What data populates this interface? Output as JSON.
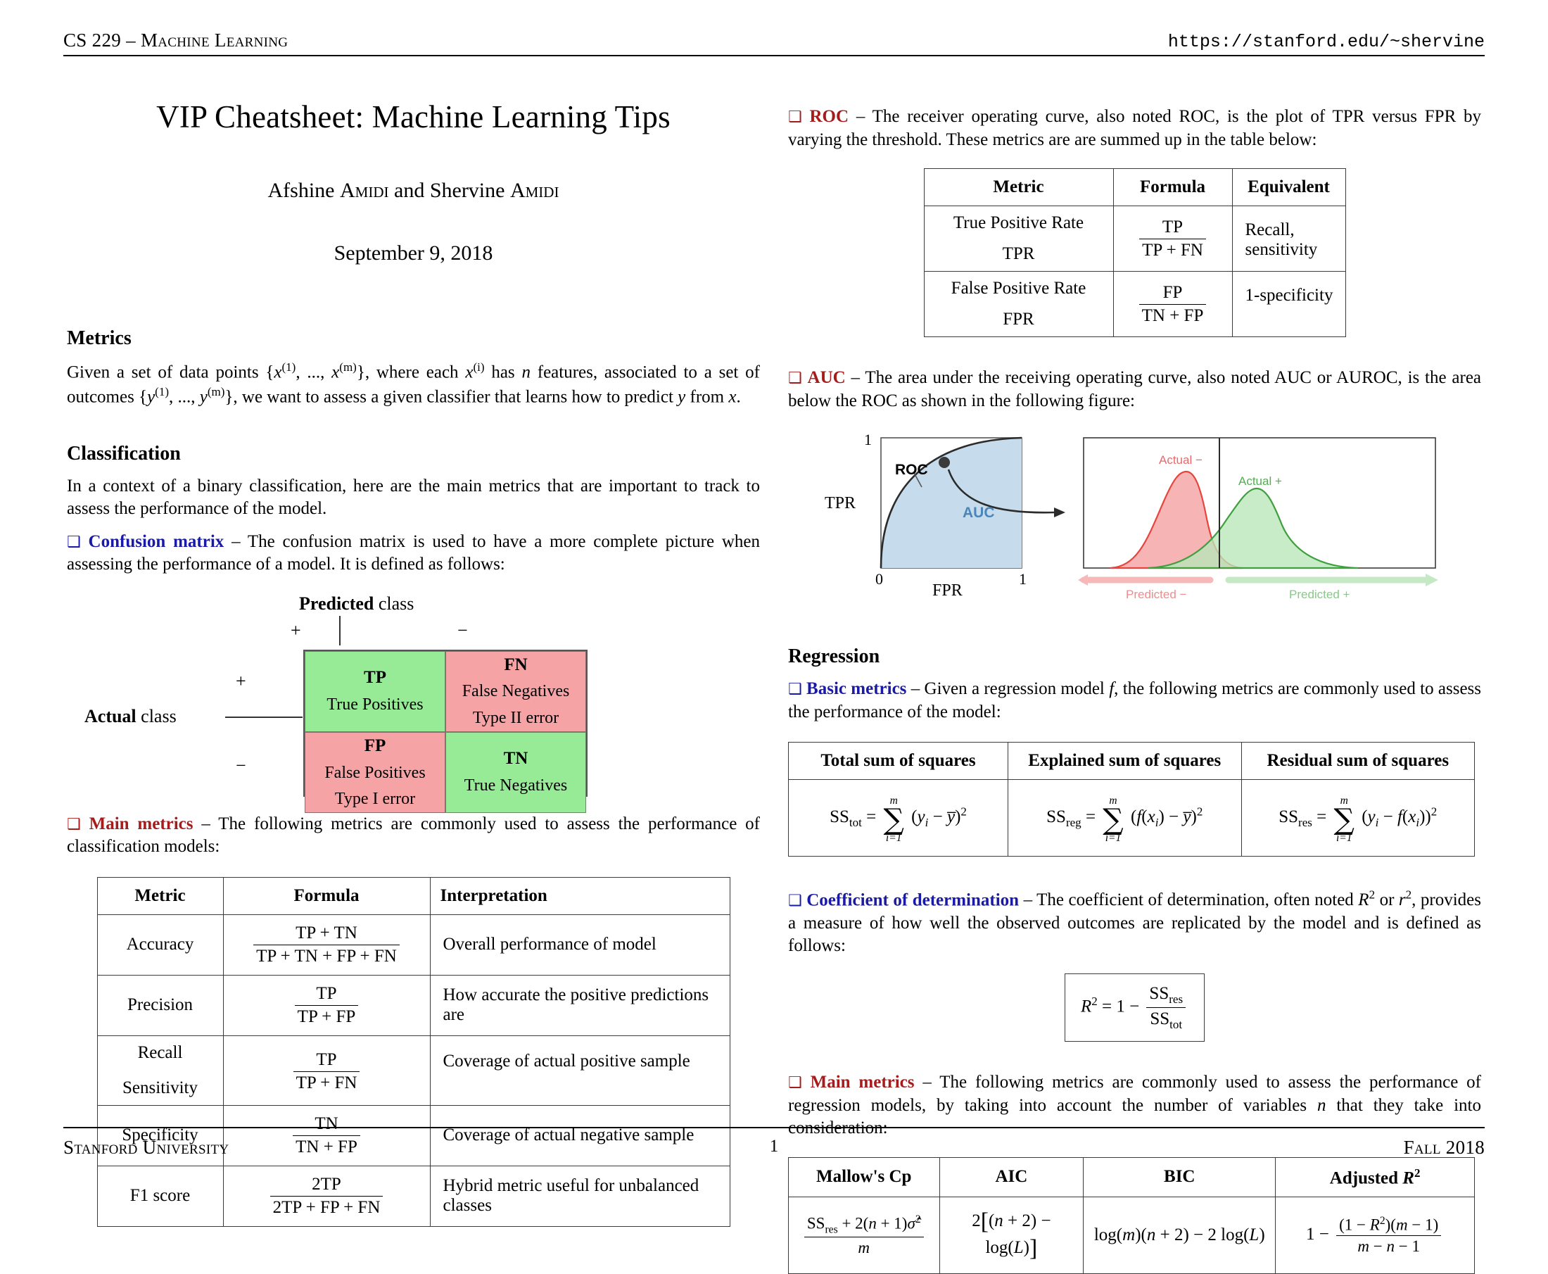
{
  "runhead": {
    "left": "CS 229 – Machine Learning",
    "right": "https://stanford.edu/~shervine"
  },
  "runfoot": {
    "left": "Stanford University",
    "page": "1",
    "right": "Fall 2018"
  },
  "title": {
    "main": "VIP Cheatsheet: Machine Learning Tips",
    "authors_pre": "Afshine ",
    "authors_name1": "Amidi",
    "authors_mid": " and Shervine ",
    "authors_name2": "Amidi",
    "date": "September 9, 2018"
  },
  "left": {
    "metrics_heading": "Metrics",
    "metrics_para": "Given a set of data points {x(1), ..., x(m)}, where each x(i) has n features, associated to a set of outcomes {y(1), ..., y(m)}, we want to assess a given classifier that learns how to predict y from x.",
    "classification_heading": "Classification",
    "classification_para": "In a context of a binary classification, here are the main metrics that are important to track to assess the performance of the model.",
    "confusion_kw": "Confusion matrix",
    "confusion_text": "– The confusion matrix is used to have a more complete picture when assessing the performance of a model. It is defined as follows:",
    "confusion_matrix": {
      "col_title_bold": "Predicted",
      "col_title_rest": " class",
      "row_title_bold": "Actual",
      "row_title_rest": " class",
      "col_plus": "+",
      "col_minus": "−",
      "row_plus": "+",
      "row_minus": "−",
      "cells": [
        {
          "code": "TP",
          "line1": "True Positives",
          "line2": "",
          "color": "green"
        },
        {
          "code": "FN",
          "line1": "False Negatives",
          "line2": "Type II error",
          "color": "pink"
        },
        {
          "code": "FP",
          "line1": "False Positives",
          "line2": "Type I error",
          "color": "pink"
        },
        {
          "code": "TN",
          "line1": "True Negatives",
          "line2": "",
          "color": "green"
        }
      ]
    },
    "main_metrics_kw": "Main metrics",
    "main_metrics_text": "– The following metrics are commonly used to assess the performance of classification models:",
    "metrics_table": {
      "headers": [
        "Metric",
        "Formula",
        "Interpretation"
      ],
      "rows": [
        {
          "metric": "Accuracy",
          "metric2": "",
          "num": "TP + TN",
          "den": "TP + TN + FP + FN",
          "interp": "Overall performance of model"
        },
        {
          "metric": "Precision",
          "metric2": "",
          "num": "TP",
          "den": "TP + FP",
          "interp": "How accurate the positive predictions are"
        },
        {
          "metric": "Recall",
          "metric2": "Sensitivity",
          "num": "TP",
          "den": "TP + FN",
          "interp": "Coverage of actual positive sample"
        },
        {
          "metric": "Specificity",
          "metric2": "",
          "num": "TN",
          "den": "TN + FP",
          "interp": "Coverage of actual negative sample"
        },
        {
          "metric": "F1 score",
          "metric2": "",
          "num": "2TP",
          "den": "2TP + FP + FN",
          "interp": "Hybrid metric useful for unbalanced classes"
        }
      ]
    }
  },
  "right": {
    "roc_kw": "ROC",
    "roc_text": "– The receiver operating curve, also noted ROC, is the plot of TPR versus FPR by varying the threshold. These metrics are are summed up in the table below:",
    "roc_table": {
      "headers": [
        "Metric",
        "Formula",
        "Equivalent"
      ],
      "rows": [
        {
          "metric": "True Positive Rate",
          "metric2": "TPR",
          "num": "TP",
          "den": "TP + FN",
          "equiv": "Recall, sensitivity"
        },
        {
          "metric": "False Positive Rate",
          "metric2": "FPR",
          "num": "FP",
          "den": "TN + FP",
          "equiv": "1-specificity"
        }
      ]
    },
    "auc_kw": "AUC",
    "auc_text": "– The area under the receiving operating curve, also noted AUC or AUROC, is the area below the ROC as shown in the following figure:",
    "auc_figure": {
      "y_top": "1",
      "y_label": "TPR",
      "x_zero": "0",
      "x_one": "1",
      "x_label": "FPR",
      "curve_label": "ROC",
      "area_label": "AUC",
      "actual_neg": "Actual −",
      "actual_pos": "Actual +",
      "predicted_neg": "Predicted −",
      "predicted_pos": "Predicted +",
      "colors": {
        "auc_fill": "#c6dcec",
        "neg": "#e8443e",
        "pos": "#3fa03f",
        "auc_text": "#4a86b8"
      }
    },
    "regression_heading": "Regression",
    "basic_kw": "Basic metrics",
    "basic_text": "– Given a regression model f, the following metrics are commonly used to assess the performance of the model:",
    "ss_table": {
      "headers": [
        "Total sum of squares",
        "Explained sum of squares",
        "Residual sum of squares"
      ],
      "cells": [
        {
          "lhs": "SS",
          "sub": "tot",
          "upper": "m",
          "lower": "i=1",
          "body": "(yᵢ − ȳ)²"
        },
        {
          "lhs": "SS",
          "sub": "reg",
          "upper": "m",
          "lower": "i=1",
          "body": "(f(xᵢ) − ȳ)²"
        },
        {
          "lhs": "SS",
          "sub": "res",
          "upper": "m",
          "lower": "i=1",
          "body": "(yᵢ − f(xᵢ))²"
        }
      ]
    },
    "coef_kw": "Coefficient of determination",
    "coef_text": "– The coefficient of determination, often noted R2 or r2, provides a measure of how well the observed outcomes are replicated by the model and is defined as follows:",
    "coef_formula": {
      "lhs": "R2 = 1 −",
      "num": "SSres",
      "den": "SStot"
    },
    "main_kw": "Main metrics",
    "main_text": "– The following metrics are commonly used to assess the performance of regression models, by taking into account the number of variables n that they take into consideration:",
    "model_table": {
      "headers": [
        "Mallow's Cp",
        "AIC",
        "BIC",
        "Adjusted R2"
      ],
      "cells": [
        {
          "num": "SSres + 2(n + 1)σ̂2",
          "den": "m"
        },
        {
          "plain": "2[(n + 2) − log(L)]"
        },
        {
          "plain": "log(m)(n + 2) − 2 log(L)"
        },
        {
          "lead": "1 −",
          "num": "(1 − R2)(m − 1)",
          "den": "m − n − 1"
        }
      ]
    }
  }
}
